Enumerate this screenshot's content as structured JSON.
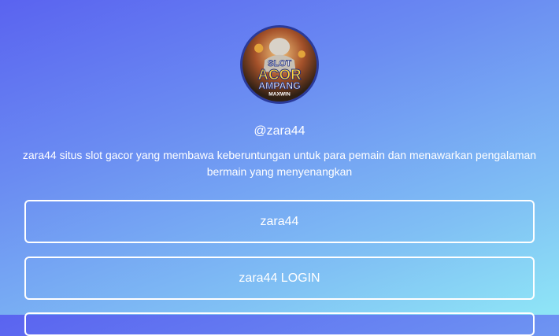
{
  "profile": {
    "avatar_icon": "slot-gacor-logo-icon",
    "avatar_text": {
      "line1": "SLOT",
      "line2": "ACOR",
      "line3": "AMPANG",
      "line4": "MAXWIN"
    },
    "handle": "@zara44",
    "bio": "zara44 situs slot gacor yang membawa keberuntungan untuk para pemain dan menawarkan pengalaman bermain yang menyenangkan"
  },
  "links": [
    {
      "label": "zara44"
    },
    {
      "label": "zara44 LOGIN"
    },
    {
      "label": ""
    }
  ],
  "colors": {
    "gradient_start": "#5a63f0",
    "gradient_end": "#8fe6f6",
    "button_border": "#ffffff",
    "text": "#ffffff"
  }
}
